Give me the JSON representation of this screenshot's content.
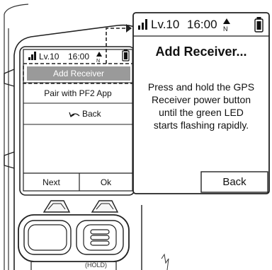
{
  "small_screen": {
    "status": {
      "level": "Lv.10",
      "time": "16:00"
    },
    "menu": [
      {
        "label": "Add Receiver",
        "selected": true
      },
      {
        "label": "Pair with PF2 App",
        "selected": false
      },
      {
        "label": "Back",
        "selected": false
      }
    ],
    "softkeys": {
      "left": "Next",
      "right": "Ok"
    }
  },
  "device": {
    "hold_label": "(HOLD)"
  },
  "popup": {
    "status": {
      "level": "Lv.10",
      "time": "16:00"
    },
    "title": "Add Receiver...",
    "message_lines": [
      "Press and hold the GPS",
      "Receiver power button",
      "until the green LED",
      "starts flashing rapidly."
    ],
    "button": "Back"
  },
  "icons": {
    "signal": "signal-bars-icon",
    "compass": "compass-north-icon",
    "battery": "battery-icon",
    "back": "back-arrow-icon",
    "hold_button": "menu-lines-icon"
  }
}
